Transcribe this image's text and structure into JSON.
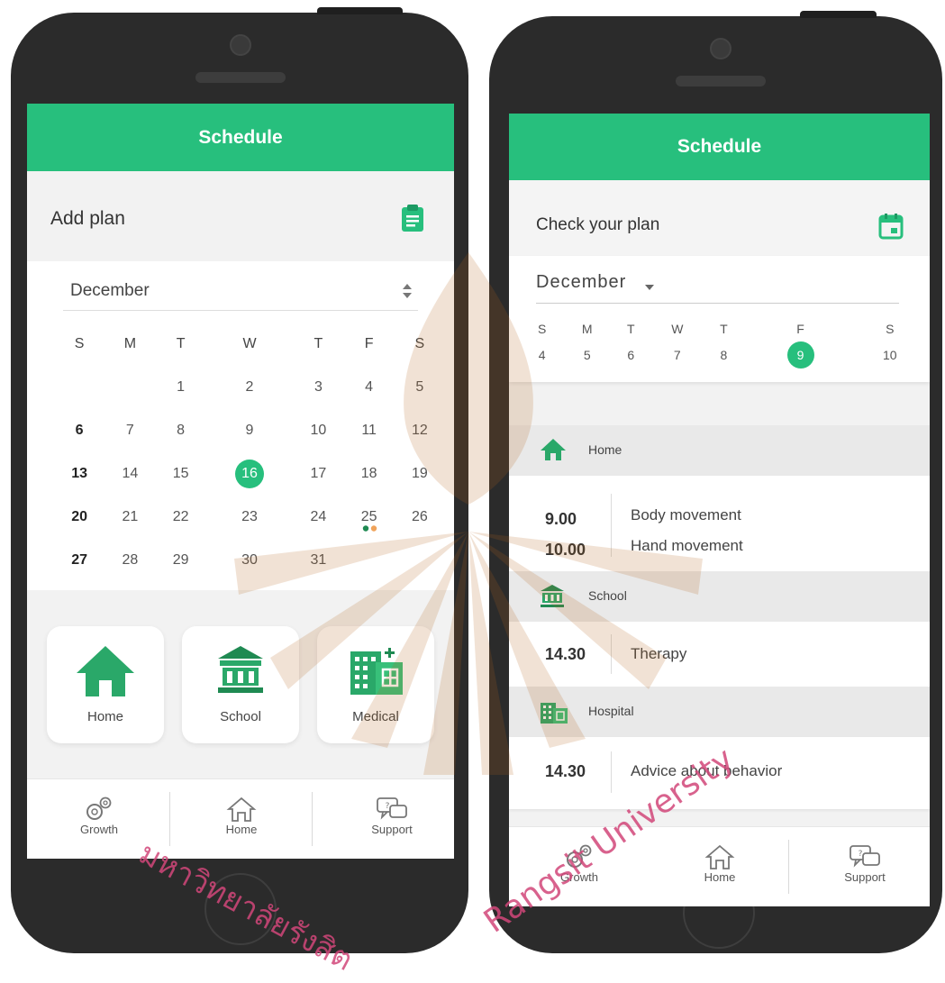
{
  "left": {
    "title": "Schedule",
    "add_plan": "Add plan",
    "month": "December",
    "weekdays": [
      "S",
      "M",
      "T",
      "W",
      "T",
      "F",
      "S"
    ],
    "weeks": [
      [
        "",
        "",
        "1",
        "2",
        "3",
        "4",
        "5"
      ],
      [
        "6",
        "7",
        "8",
        "9",
        "10",
        "11",
        "12"
      ],
      [
        "13",
        "14",
        "15",
        "16",
        "17",
        "18",
        "19"
      ],
      [
        "20",
        "21",
        "22",
        "23",
        "24",
        "25",
        "26"
      ],
      [
        "27",
        "28",
        "29",
        "30",
        "31",
        "",
        ""
      ]
    ],
    "selected_day": "16",
    "marked_day": "25",
    "tiles": {
      "home": "Home",
      "school": "School",
      "medical": "Medical"
    },
    "nav": {
      "growth": "Growth",
      "home": "Home",
      "support": "Support"
    }
  },
  "right": {
    "title": "Schedule",
    "check_plan": "Check your plan",
    "month": "December",
    "weekdays": [
      "S",
      "M",
      "T",
      "W",
      "T",
      "F",
      "S"
    ],
    "days": [
      "4",
      "5",
      "6",
      "7",
      "8",
      "9",
      "10"
    ],
    "selected_day": "9",
    "sections": [
      {
        "name": "Home",
        "icon": "house-icon",
        "entries": [
          {
            "time": "9.00",
            "desc": "Body movement"
          },
          {
            "time": "10.00",
            "desc": "Hand movement"
          }
        ]
      },
      {
        "name": "School",
        "icon": "school-icon",
        "entries": [
          {
            "time": "14.30",
            "desc": "Therapy"
          }
        ]
      },
      {
        "name": "Hospital",
        "icon": "hospital-icon",
        "entries": [
          {
            "time": "14.30",
            "desc": "Advice about behavior"
          }
        ]
      }
    ],
    "nav": {
      "growth": "Growth",
      "home": "Home",
      "support": "Support"
    }
  },
  "watermark": {
    "thai": "มหาวิทยาลัยรังสิต",
    "english": "Rangsit University"
  },
  "colors": {
    "accent": "#27bf7d",
    "phone": "#2b2b2b",
    "dot_orange": "#f0a35a",
    "dot_green": "#1f8a52"
  }
}
